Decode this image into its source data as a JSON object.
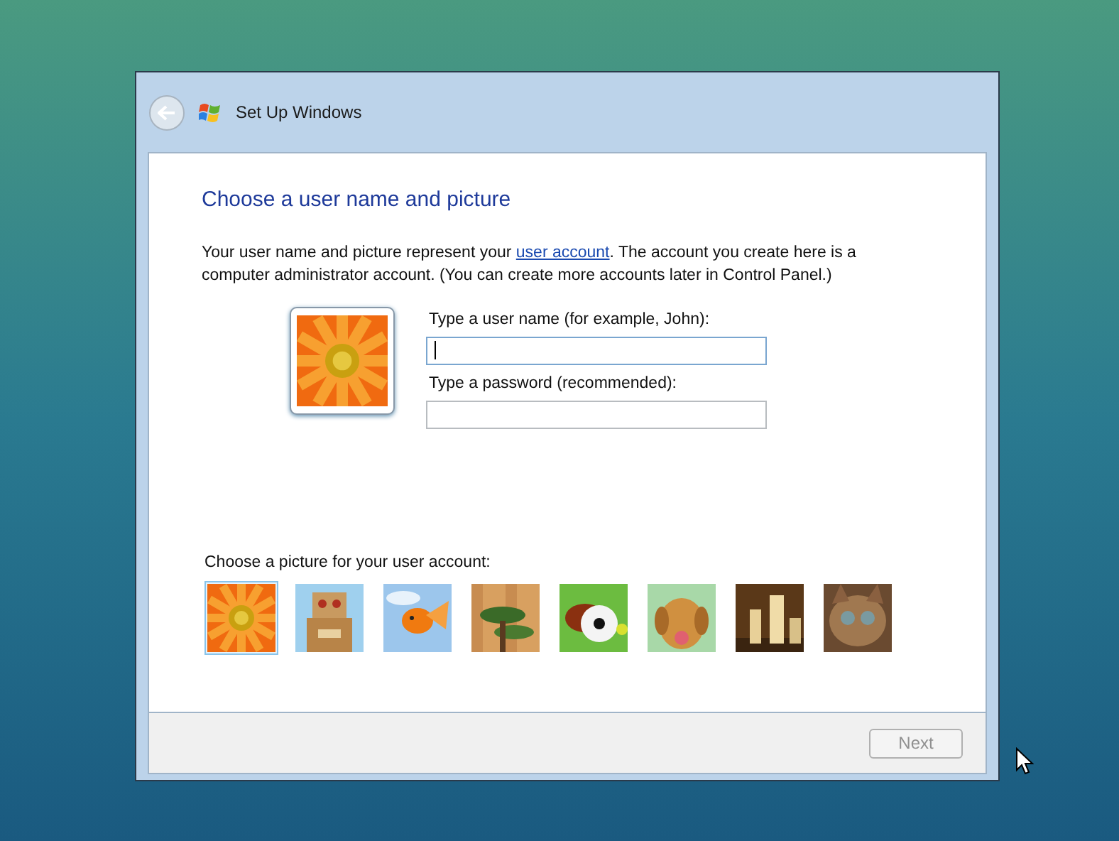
{
  "window": {
    "title": "Set Up Windows",
    "back_disabled": true
  },
  "heading": "Choose a user name and picture",
  "intro": {
    "before": "Your user name and picture represent your ",
    "link": "user account",
    "after": ". The account you create here is a computer administrator account. (You can create more accounts later in Control Panel.)"
  },
  "fields": [
    {
      "label": "Type a user name (for example, John):",
      "focused": true
    },
    {
      "label": "Type a password (recommended):",
      "focused": false
    }
  ],
  "picture_chooser": {
    "label": "Choose a picture for your user account:",
    "pictures": [
      {
        "selected": true
      },
      {
        "selected": false
      },
      {
        "selected": false
      },
      {
        "selected": false
      },
      {
        "selected": false
      },
      {
        "selected": false
      },
      {
        "selected": false
      },
      {
        "selected": false
      }
    ]
  },
  "next_button": {
    "label": "Next",
    "disabled": true
  }
}
